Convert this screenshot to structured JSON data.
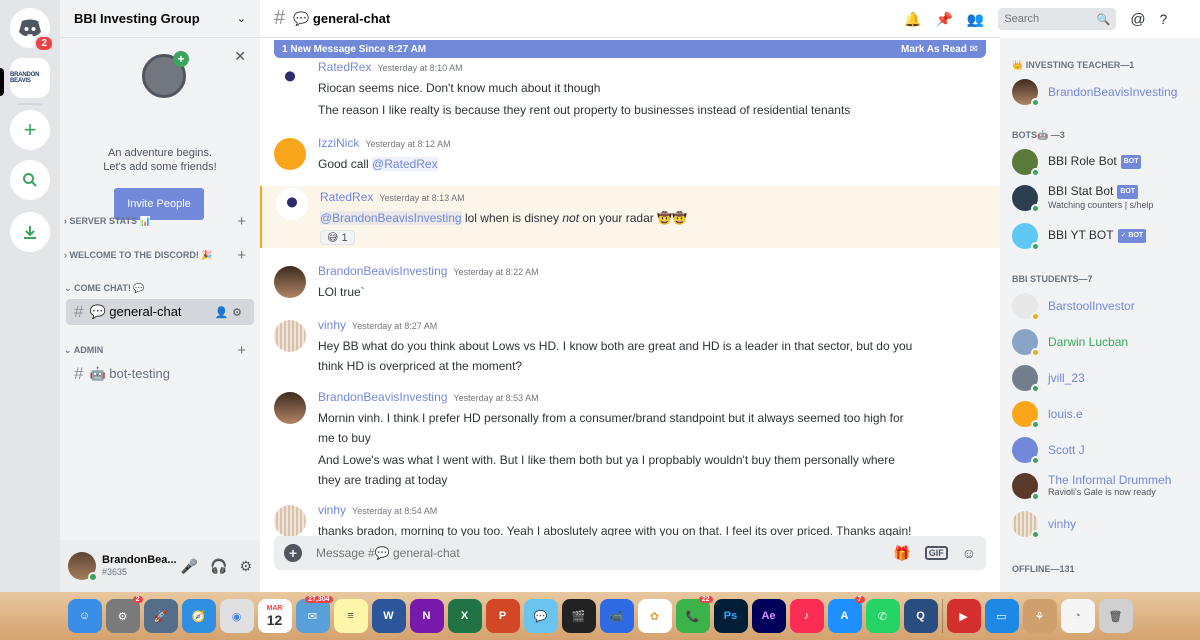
{
  "guild_bar": {
    "home_badge": "2",
    "server_logo_text": "BRANDON BEAVIS"
  },
  "sidebar": {
    "guild_name": "BBI Investing Group",
    "welcome_line1": "An adventure begins.",
    "welcome_line2": "Let's add some friends!",
    "invite_label": "Invite People",
    "categories": [
      {
        "label": "SERVER STATS 📊"
      },
      {
        "label": "WELCOME TO THE DISCORD! 🎉"
      },
      {
        "label": "COME CHAT! 💬"
      },
      {
        "label": "ADMIN"
      }
    ],
    "channels": [
      {
        "label": "💬 general-chat"
      },
      {
        "label": "🤖 bot-testing"
      }
    ],
    "user": {
      "name": "BrandonBea...",
      "tag": "#3635"
    }
  },
  "header": {
    "channel": "💬 general-chat",
    "search_placeholder": "Search"
  },
  "new_messages": {
    "text": "1 New Message Since 8:27 AM",
    "action": "Mark As Read"
  },
  "messages": [
    {
      "author": "RatedRex",
      "time": "Yesterday at 8:10 AM",
      "lines": [
        "Riocan seems nice. Don't know much about it though",
        "The reason I like realty is because they rent out property to businesses instead of residential tenants"
      ]
    },
    {
      "author": "IzziNick",
      "time": "Yesterday at 8:12 AM",
      "text": "Good call",
      "mention": "@RatedRex"
    },
    {
      "author": "RatedRex",
      "time": "Yesterday at 8:13 AM",
      "mention": "@BrandonBeavisInvesting",
      "text_a": "lol when is disney",
      "em": "not",
      "text_b": "on your radar 🤠🤠",
      "reaction": "😅 1"
    },
    {
      "author": "BrandonBeavisInvesting",
      "time": "Yesterday at 8:22 AM",
      "lines": [
        "LOl true`"
      ]
    },
    {
      "author": "vinhy",
      "time": "Yesterday at 8:27 AM",
      "lines": [
        "Hey BB what do you think about Lows vs HD. I know both are great and HD is a leader in that sector, but do you",
        "think HD is overpriced at the moment?"
      ]
    },
    {
      "author": "BrandonBeavisInvesting",
      "time": "Yesterday at 8:53 AM",
      "lines": [
        "Mornin vinh. I think I prefer HD personally from a consumer/brand standpoint but it always seemed too high for",
        "me to buy",
        "And Lowe's was what I went with. But I like them both but ya I propbably wouldn't buy them personally where",
        "they are trading at today"
      ]
    },
    {
      "author": "vinhy",
      "time": "Yesterday at 8:54 AM",
      "lines": [
        "thanks bradon, morning to you too. Yeah I aboslutely agree with you on that. I feel its over priced. Thanks again!"
      ]
    }
  ],
  "composer": {
    "placeholder": "Message #💬 general-chat",
    "gif_label": "GIF"
  },
  "members": {
    "groups": [
      {
        "label": "👑 INVESTING TEACHER—1"
      },
      {
        "label": "BOTS🤖 —3"
      },
      {
        "label": "BBI STUDENTS—7"
      },
      {
        "label": "OFFLINE—131"
      }
    ],
    "list": [
      {
        "name": "BrandonBeavisInvesting"
      },
      {
        "name": "BBI Role Bot",
        "tag": "BOT"
      },
      {
        "name": "BBI Stat Bot",
        "tag": "BOT",
        "sub": "Watching counters | s/help"
      },
      {
        "name": "BBI YT BOT",
        "tag": "✓ BOT"
      },
      {
        "name": "BarstoolInvestor"
      },
      {
        "name": "Darwin Lucban"
      },
      {
        "name": "jvill_23"
      },
      {
        "name": "louis.e"
      },
      {
        "name": "Scott J"
      },
      {
        "name": "The Informal Drummeh",
        "sub": "Ravioli's Gale is now ready"
      },
      {
        "name": "vinhy"
      }
    ]
  },
  "dock": {
    "calendar_day": "12",
    "calendar_month": "MAR",
    "badges": [
      "2",
      "27,304",
      "22",
      "7"
    ],
    "apps": [
      "W",
      "N",
      "X",
      "P",
      "Ps",
      "Ae"
    ]
  },
  "colors": {
    "accent": "#7289da",
    "online": "#3ba55d",
    "alert": "#ed4245",
    "mention_highlight": "#faa61a",
    "darwin_name": "#3ba55d"
  }
}
